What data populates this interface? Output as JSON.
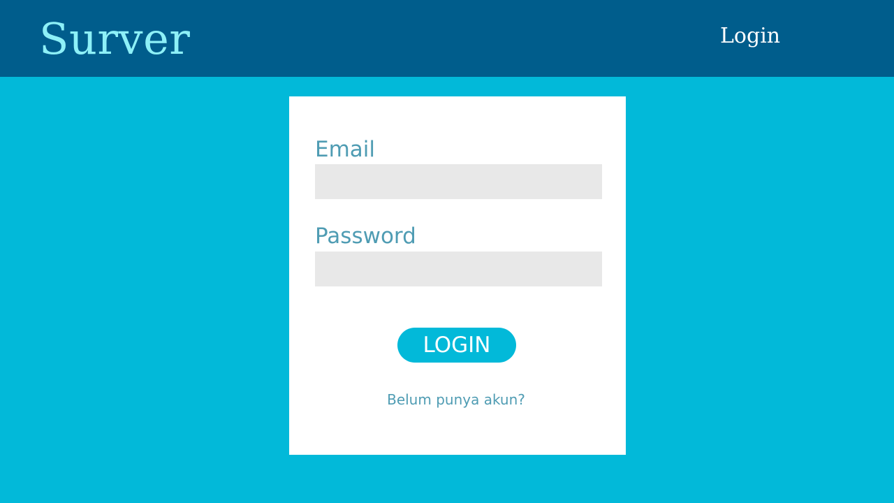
{
  "header": {
    "brand": "Surver",
    "nav_login": "Login"
  },
  "login_form": {
    "email_label": "Email",
    "email_value": "",
    "password_label": "Password",
    "password_value": "",
    "submit_label": "LOGIN",
    "signup_prompt": "Belum punya akun?"
  },
  "colors": {
    "page_background": "#02b9d9",
    "header_background": "#005d8c",
    "brand_text": "#8df0f7",
    "card_background": "#ffffff",
    "label_text": "#4f9cb3",
    "input_background": "#e8e8e8",
    "button_background": "#02b9d9",
    "button_text": "#ffffff"
  }
}
